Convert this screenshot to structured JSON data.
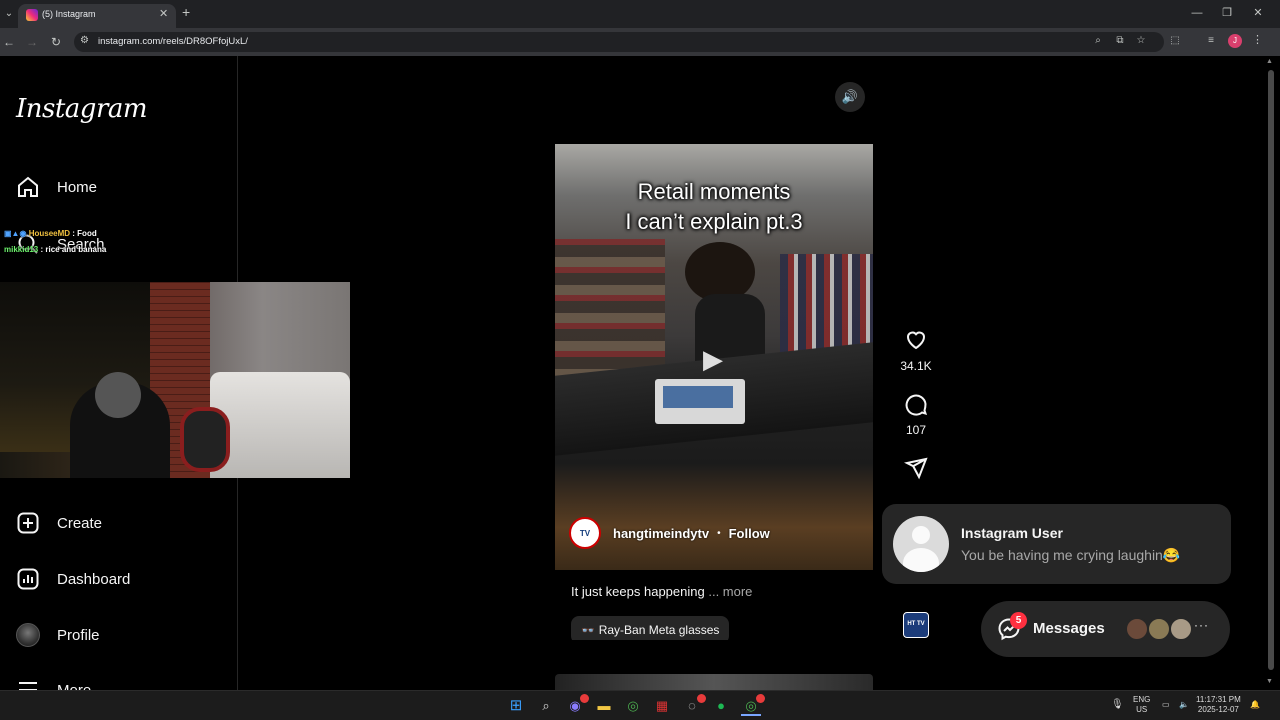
{
  "browser": {
    "tab_title": "(5) Instagram",
    "url": "instagram.com/reels/DR8OFfojUxL/",
    "profile_initial": "J"
  },
  "sidebar": {
    "logo": "Instagram",
    "items": [
      {
        "label": "Home"
      },
      {
        "label": "Search"
      },
      {
        "label": "Create"
      },
      {
        "label": "Dashboard"
      },
      {
        "label": "Profile"
      },
      {
        "label": "More"
      }
    ]
  },
  "chat_overlay": [
    {
      "user": "HouseeMD",
      "message": ": Food"
    },
    {
      "user": "mikkid13",
      "message": ": rice and banana"
    }
  ],
  "reel": {
    "caption": "Retail moments\nI can’t explain pt.3",
    "author": "hangtimeindytv",
    "author_avatar_text": "TV",
    "follow_label": "Follow",
    "description": "It just keeps happening",
    "more_label": "... more",
    "product_tag": "Ray-Ban Meta glasses"
  },
  "actions": {
    "likes": "34.1K",
    "comments": "107",
    "audio_thumb_text": "HT TV"
  },
  "notification": {
    "title": "Instagram User",
    "text": "You be having me crying laughin😂"
  },
  "messages": {
    "label": "Messages",
    "badge": "5"
  },
  "taskbar": {
    "language_top": "ENG",
    "language_bottom": "US",
    "time": "11:17:31 PM",
    "date": "2025-12-07"
  },
  "colors": {
    "background": "#000000",
    "panel": "#262626",
    "badge_red": "#ff3040",
    "text_secondary": "#a8a8a8"
  }
}
